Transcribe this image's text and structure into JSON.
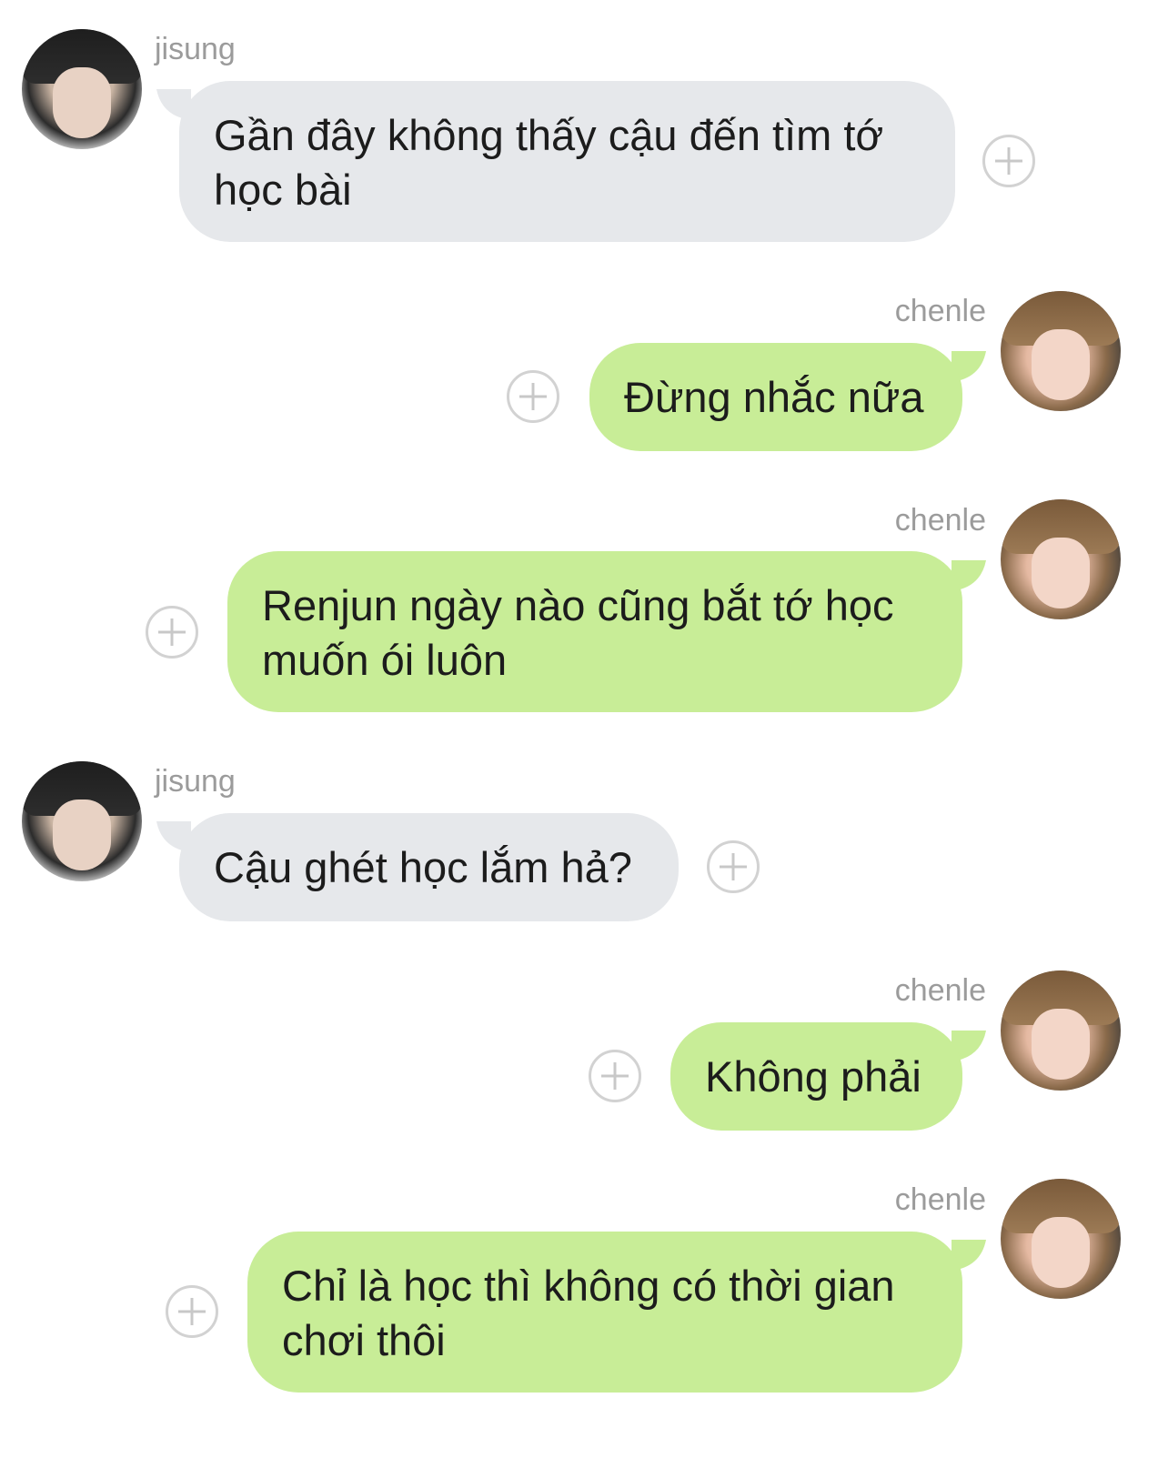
{
  "messages": [
    {
      "sender": "jisung",
      "text": "Gần đây không thấy cậu đến tìm tớ học bài"
    },
    {
      "sender": "chenle",
      "text": "Đừng nhắc nữa"
    },
    {
      "sender": "chenle",
      "text": "Renjun ngày nào cũng bắt tớ học muốn ói luôn"
    },
    {
      "sender": "jisung",
      "text": "Cậu ghét học lắm hả?"
    },
    {
      "sender": "chenle",
      "text": "Không phải"
    },
    {
      "sender": "chenle",
      "text": "Chỉ là học thì không có thời gian chơi thôi"
    }
  ],
  "colors": {
    "incoming_bubble": "#e6e8eb",
    "outgoing_bubble": "#c8ed97",
    "sender_name": "#9b9b9b",
    "background": "#ffffff"
  },
  "icons": {
    "add": "plus-circle-icon"
  }
}
